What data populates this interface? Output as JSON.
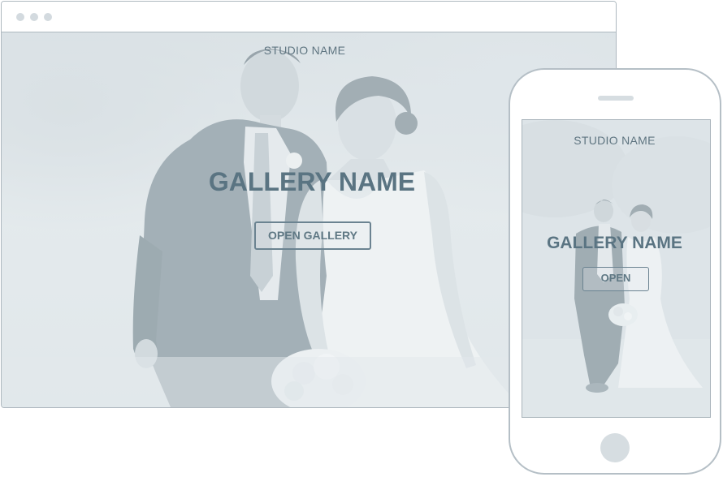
{
  "desktop": {
    "studio_name": "STUDIO NAME",
    "gallery_name": "GALLERY NAME",
    "button_label": "OPEN GALLERY"
  },
  "phone": {
    "studio_name": "STUDIO NAME",
    "gallery_name": "GALLERY NAME",
    "button_label": "OPEN"
  },
  "colors": {
    "accent_text": "#5a7482",
    "frame_border": "#aeb8bf",
    "photo_tint": "#dfe5e9"
  },
  "icons": {
    "window_controls": "window-dot-icon",
    "phone_speaker": "speaker-icon",
    "phone_home": "home-button-icon"
  }
}
